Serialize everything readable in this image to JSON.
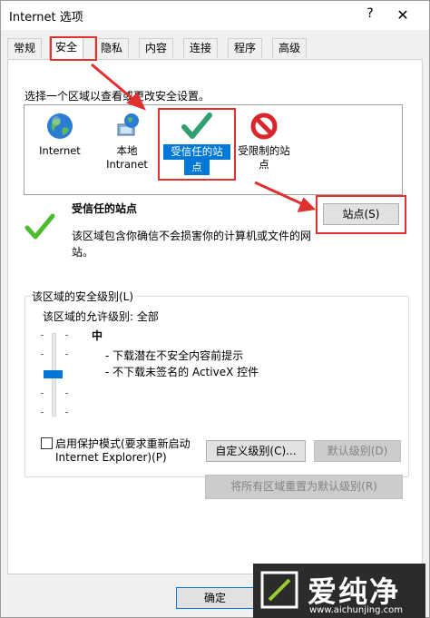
{
  "window": {
    "title": "Internet 选项",
    "help_glyph": "?",
    "close_glyph": "✕"
  },
  "tabs": [
    {
      "label": "常规"
    },
    {
      "label": "安全"
    },
    {
      "label": "隐私"
    },
    {
      "label": "内容"
    },
    {
      "label": "连接"
    },
    {
      "label": "程序"
    },
    {
      "label": "高级"
    }
  ],
  "security": {
    "instruction": "选择一个区域以查看或更改安全设置。",
    "zones": [
      {
        "line1": "Internet",
        "line2": "",
        "icon": "globe-icon"
      },
      {
        "line1": "本地",
        "line2": "Intranet",
        "icon": "intranet-icon"
      },
      {
        "line1": "受信任的站",
        "line2": "点",
        "icon": "checkmark-icon",
        "selected": true
      },
      {
        "line1": "受限制的站",
        "line2": "点",
        "icon": "prohibited-icon"
      }
    ],
    "selected_zone": {
      "title": "受信任的站点",
      "description_line1": "该区域包含你确信不会损害你的计算机或文件的网",
      "description_line2": "站。"
    },
    "sites_button": "站点(S)",
    "level_group_title": "该区域的安全级别(L)",
    "allowed_levels": "该区域的允许级别: 全部",
    "level_name": "中",
    "level_bullets": [
      "- 下载潜在不安全内容前提示",
      "- 不下载未签名的 ActiveX 控件"
    ],
    "slider_level": 0.5,
    "protected_mode_line1": "启用保护模式(要求重新启动",
    "protected_mode_line2": "Internet Explorer)(P)",
    "protected_mode_checked": false,
    "custom_level_button": "自定义级别(C)...",
    "default_level_button": "默认级别(D)",
    "reset_all_button": "将所有区域重置为默认级别(R)"
  },
  "footer": {
    "ok_button": "确定"
  },
  "watermark": {
    "brand": "爱纯净",
    "url": "www.aichunjing.com"
  },
  "colors": {
    "accent": "#0078d7",
    "annotation": "#e03030"
  }
}
